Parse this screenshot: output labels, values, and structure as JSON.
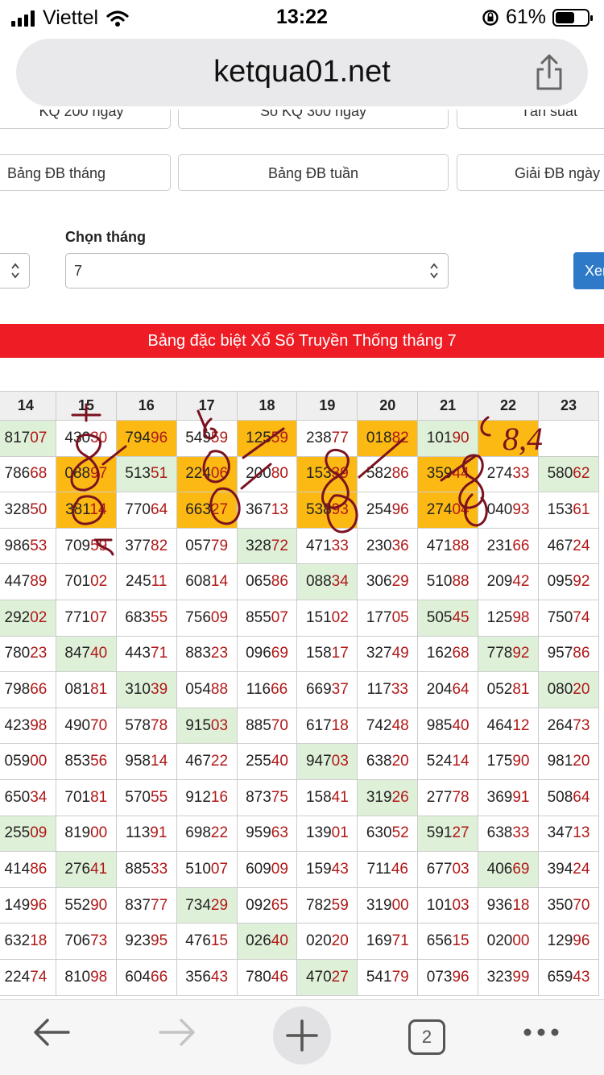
{
  "status": {
    "carrier": "Viettel",
    "time": "13:22",
    "battery": "61%",
    "battery_level": 0.61
  },
  "browser": {
    "url": "ketqua01.net",
    "tab_count": "2"
  },
  "nav_buttons": {
    "row1": [
      "KQ 200 ngày",
      "Sổ KQ 300 ngày",
      "Tần suất"
    ],
    "row2": [
      "Bảng ĐB tháng",
      "Bảng ĐB tuần",
      "Giải ĐB ngày"
    ]
  },
  "form": {
    "month_label": "Chọn tháng",
    "month_value": "7",
    "submit": "Xem"
  },
  "banner": "Bảng đặc biệt Xổ Số Truyền Thống tháng 7",
  "table": {
    "columns": [
      "14",
      "15",
      "16",
      "17",
      "18",
      "19",
      "20",
      "21",
      "22",
      "23"
    ],
    "rows": [
      [
        [
          "81707",
          "g"
        ],
        [
          "43030",
          ""
        ],
        [
          "79496",
          "o"
        ],
        [
          "54959",
          ""
        ],
        [
          "12559",
          "o"
        ],
        [
          "23877",
          ""
        ],
        [
          "01882",
          "o"
        ],
        [
          "10190",
          "g"
        ],
        [
          "",
          "o"
        ],
        [
          "",
          ""
        ]
      ],
      [
        [
          "78668",
          ""
        ],
        [
          "08897",
          "o"
        ],
        [
          "51351",
          "g"
        ],
        [
          "22406",
          "o"
        ],
        [
          "20080",
          ""
        ],
        [
          "15339",
          "o"
        ],
        [
          "58286",
          ""
        ],
        [
          "35944",
          "o"
        ],
        [
          "27433",
          ""
        ],
        [
          "58062",
          "g"
        ]
      ],
      [
        [
          "32850",
          ""
        ],
        [
          "38114",
          "o"
        ],
        [
          "77064",
          ""
        ],
        [
          "66327",
          "o"
        ],
        [
          "36713",
          ""
        ],
        [
          "53893",
          "o"
        ],
        [
          "25496",
          ""
        ],
        [
          "27404",
          "o"
        ],
        [
          "04093",
          ""
        ],
        [
          "15361",
          ""
        ]
      ],
      [
        [
          "98653",
          ""
        ],
        [
          "70959",
          ""
        ],
        [
          "37782",
          ""
        ],
        [
          "05779",
          ""
        ],
        [
          "32872",
          "g"
        ],
        [
          "47133",
          ""
        ],
        [
          "23036",
          ""
        ],
        [
          "47188",
          ""
        ],
        [
          "23166",
          ""
        ],
        [
          "46724",
          ""
        ]
      ],
      [
        [
          "44789",
          ""
        ],
        [
          "70102",
          ""
        ],
        [
          "24511",
          ""
        ],
        [
          "60814",
          ""
        ],
        [
          "06586",
          ""
        ],
        [
          "08834",
          "g"
        ],
        [
          "30629",
          ""
        ],
        [
          "51088",
          ""
        ],
        [
          "20942",
          ""
        ],
        [
          "09592",
          ""
        ]
      ],
      [
        [
          "29202",
          "g"
        ],
        [
          "77107",
          ""
        ],
        [
          "68355",
          ""
        ],
        [
          "75609",
          ""
        ],
        [
          "85507",
          ""
        ],
        [
          "15102",
          ""
        ],
        [
          "17705",
          ""
        ],
        [
          "50545",
          "g"
        ],
        [
          "12598",
          ""
        ],
        [
          "75074",
          ""
        ]
      ],
      [
        [
          "78023",
          ""
        ],
        [
          "84740",
          "g"
        ],
        [
          "44371",
          ""
        ],
        [
          "88323",
          ""
        ],
        [
          "09669",
          ""
        ],
        [
          "15817",
          ""
        ],
        [
          "32749",
          ""
        ],
        [
          "16268",
          ""
        ],
        [
          "77892",
          "g"
        ],
        [
          "95786",
          ""
        ]
      ],
      [
        [
          "79866",
          ""
        ],
        [
          "08181",
          ""
        ],
        [
          "31039",
          "g"
        ],
        [
          "05488",
          ""
        ],
        [
          "11666",
          ""
        ],
        [
          "66937",
          ""
        ],
        [
          "11733",
          ""
        ],
        [
          "20464",
          ""
        ],
        [
          "05281",
          ""
        ],
        [
          "08020",
          "g"
        ]
      ],
      [
        [
          "42398",
          ""
        ],
        [
          "49070",
          ""
        ],
        [
          "57878",
          ""
        ],
        [
          "91503",
          "g"
        ],
        [
          "88570",
          ""
        ],
        [
          "61718",
          ""
        ],
        [
          "74248",
          ""
        ],
        [
          "98540",
          ""
        ],
        [
          "46412",
          ""
        ],
        [
          "26473",
          ""
        ]
      ],
      [
        [
          "05900",
          ""
        ],
        [
          "85356",
          ""
        ],
        [
          "95814",
          ""
        ],
        [
          "46722",
          ""
        ],
        [
          "25540",
          ""
        ],
        [
          "94703",
          "g"
        ],
        [
          "63820",
          ""
        ],
        [
          "52414",
          ""
        ],
        [
          "17590",
          ""
        ],
        [
          "98120",
          ""
        ]
      ],
      [
        [
          "65034",
          ""
        ],
        [
          "70181",
          ""
        ],
        [
          "57055",
          ""
        ],
        [
          "91216",
          ""
        ],
        [
          "87375",
          ""
        ],
        [
          "15841",
          ""
        ],
        [
          "31926",
          "g"
        ],
        [
          "27778",
          ""
        ],
        [
          "36991",
          ""
        ],
        [
          "50864",
          ""
        ]
      ],
      [
        [
          "25509",
          "g"
        ],
        [
          "81900",
          ""
        ],
        [
          "11391",
          ""
        ],
        [
          "69822",
          ""
        ],
        [
          "95963",
          ""
        ],
        [
          "13901",
          ""
        ],
        [
          "63052",
          ""
        ],
        [
          "59127",
          "g"
        ],
        [
          "63833",
          ""
        ],
        [
          "34713",
          ""
        ]
      ],
      [
        [
          "41486",
          ""
        ],
        [
          "27641",
          "g"
        ],
        [
          "88533",
          ""
        ],
        [
          "51007",
          ""
        ],
        [
          "60909",
          ""
        ],
        [
          "15943",
          ""
        ],
        [
          "71146",
          ""
        ],
        [
          "67703",
          ""
        ],
        [
          "40669",
          "g"
        ],
        [
          "39424",
          ""
        ]
      ],
      [
        [
          "14996",
          ""
        ],
        [
          "55290",
          ""
        ],
        [
          "83777",
          ""
        ],
        [
          "73429",
          "g"
        ],
        [
          "09265",
          ""
        ],
        [
          "78259",
          ""
        ],
        [
          "31900",
          ""
        ],
        [
          "10103",
          ""
        ],
        [
          "93618",
          ""
        ],
        [
          "35070",
          ""
        ]
      ],
      [
        [
          "63218",
          ""
        ],
        [
          "70673",
          ""
        ],
        [
          "92395",
          ""
        ],
        [
          "47615",
          ""
        ],
        [
          "02640",
          "g"
        ],
        [
          "02020",
          ""
        ],
        [
          "16971",
          ""
        ],
        [
          "65615",
          ""
        ],
        [
          "02000",
          ""
        ],
        [
          "12996",
          ""
        ]
      ],
      [
        [
          "22474",
          ""
        ],
        [
          "81098",
          ""
        ],
        [
          "60466",
          ""
        ],
        [
          "35643",
          ""
        ],
        [
          "78046",
          ""
        ],
        [
          "47027",
          "g"
        ],
        [
          "54179",
          ""
        ],
        [
          "07396",
          ""
        ],
        [
          "32399",
          ""
        ],
        [
          "65943",
          ""
        ]
      ]
    ]
  },
  "handwriting": {
    "note": "8,4"
  }
}
